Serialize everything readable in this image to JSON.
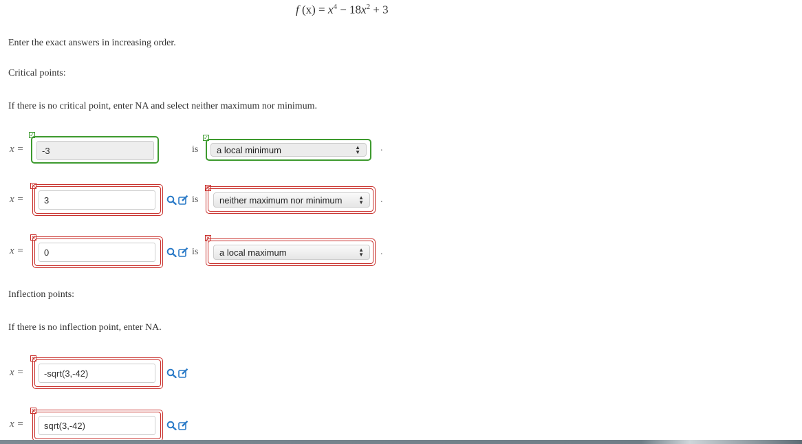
{
  "formula": {
    "f": "f",
    "x_arg": "(x) =",
    "x": "x",
    "exp4": "4",
    "minus": "− 18",
    "exp2": "2",
    "plus": "+ 3"
  },
  "instructions": {
    "order": "Enter the exact answers in increasing order.",
    "critical_heading": "Critical points:",
    "critical_note": "If there is no critical point, enter NA and select neither maximum nor minimum.",
    "inflection_heading": "Inflection points:",
    "inflection_note": "If there is no inflection point, enter NA."
  },
  "x_label": "x =",
  "is_label": "is",
  "critical_points": [
    {
      "value": "-3",
      "classification": "a local minimum",
      "value_status": "correct",
      "class_status": "correct"
    },
    {
      "value": "3",
      "classification": "neither maximum nor minimum",
      "value_status": "incorrect",
      "class_status": "incorrect"
    },
    {
      "value": "0",
      "classification": "a local maximum",
      "value_status": "incorrect",
      "class_status": "incorrect"
    }
  ],
  "inflection_points": [
    {
      "value": "-sqrt(3,-42)",
      "status": "incorrect"
    },
    {
      "value": "sqrt(3,-42)",
      "status": "incorrect"
    }
  ],
  "icons": {
    "check": "check-icon",
    "cross": "cross-icon",
    "search": "search-icon",
    "edit": "edit-icon"
  },
  "colors": {
    "correct": "#3d9a2e",
    "incorrect": "#c9302c",
    "icon_blue": "#2a7ac7"
  }
}
